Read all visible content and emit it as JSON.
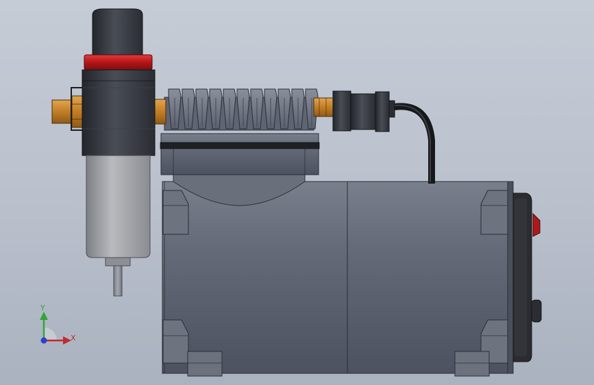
{
  "viewport": {
    "background_top": "#c6ccd6",
    "background_bottom": "#aab2bf"
  },
  "model": {
    "parts": [
      "air-filter-regulator",
      "pressure-gauge-ring",
      "brass-inlet-fitting",
      "brass-outlet-fitting",
      "cylinder-head-cooling-fins",
      "compressor-cylinder",
      "motor-housing",
      "end-cap",
      "power-switch",
      "power-cord",
      "mounting-feet"
    ],
    "colors": {
      "body": "#5f6574",
      "dark": "#2d3036",
      "brass": "#c7882c",
      "red_ring": "#c0181b",
      "filter_bowl": "#a3a5aa",
      "switch_red": "#b01818"
    }
  },
  "triad": {
    "y_label": "Y",
    "x_label": "X",
    "y_color": "#2fa53a",
    "x_color": "#c12a2a",
    "z_color": "#2d40c8"
  }
}
